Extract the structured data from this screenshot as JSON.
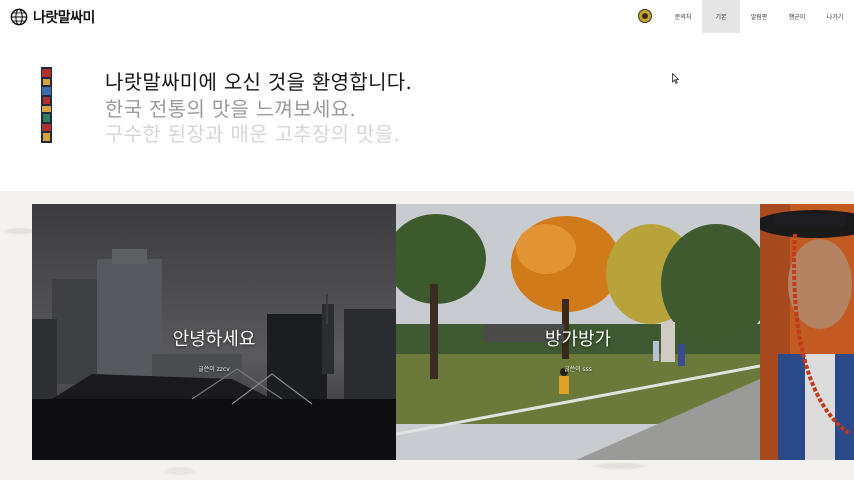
{
  "header": {
    "logo_text": "나랏말싸미",
    "logo_icon": "globe-icon",
    "nav": [
      {
        "label": "문의처",
        "active": false
      },
      {
        "label": "기본",
        "active": true
      },
      {
        "label": "알림판",
        "active": false
      },
      {
        "label": "행군이",
        "active": false
      },
      {
        "label": "나가기",
        "active": false
      }
    ]
  },
  "hero": {
    "line1": "나랏말싸미에 오신 것을 환영합니다.",
    "line2": "한국 전통의 맛을 느껴보세요.",
    "line3": "구수한 된장과 매운 고추장의 맛을."
  },
  "slides": [
    {
      "title": "안녕하세요",
      "caption": "글쓴이 zzcv"
    },
    {
      "title": "방가방가",
      "caption": "글쓴이 sss"
    },
    {
      "title": "",
      "caption": ""
    }
  ],
  "colors": {
    "nav_active_bg": "#e6e6e6",
    "band_bg": "#f3f2ee",
    "hero_primary": "#151515",
    "hero_secondary": "#9a9a9a",
    "hero_tertiary": "#d6d6d6"
  }
}
